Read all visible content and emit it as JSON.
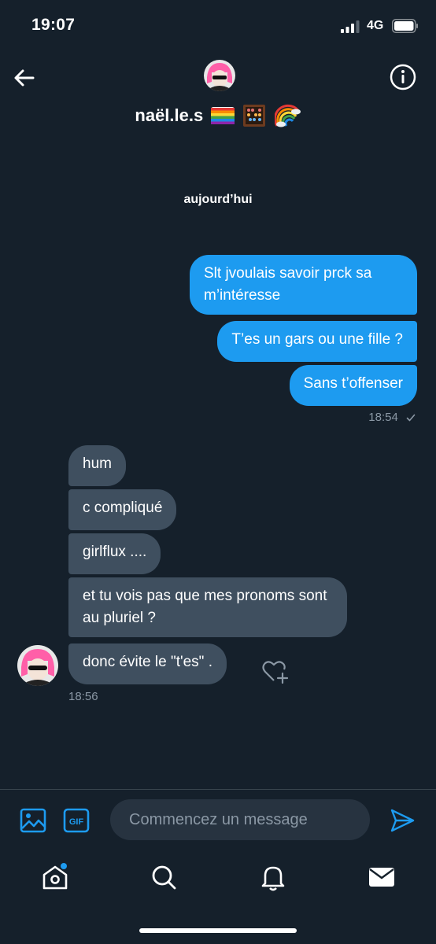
{
  "status_bar": {
    "time": "19:07",
    "network": "4G"
  },
  "header": {
    "name": "naël.le.s"
  },
  "day_divider": "aujourd’hui",
  "messages_sent": [
    {
      "text": "Slt jvoulais savoir prck sa m’intéresse"
    },
    {
      "text": "T’es un gars ou une fille ?"
    },
    {
      "text": "Sans t’offenser"
    }
  ],
  "sent_timestamp": "18:54",
  "messages_received": [
    {
      "text": "hum"
    },
    {
      "text": "c compliqué"
    },
    {
      "text": "girlflux ...."
    },
    {
      "text": "et tu vois pas que mes pronoms sont au pluriel ?"
    },
    {
      "text": "donc évite le \"t'es\" ."
    }
  ],
  "received_timestamp": "18:56",
  "composer": {
    "placeholder": "Commencez un message",
    "gif_label": "GIF"
  },
  "colors": {
    "background": "#15202b",
    "accent": "#1d9bf0",
    "incoming_bubble": "#3f4f5f",
    "muted": "#8b98a5"
  },
  "icons": {
    "header": [
      "back-arrow-icon",
      "info-icon"
    ],
    "composer": [
      "image-icon",
      "gif-icon",
      "send-icon"
    ],
    "tabs": [
      "home-icon",
      "search-icon",
      "bell-icon",
      "mail-icon"
    ]
  }
}
